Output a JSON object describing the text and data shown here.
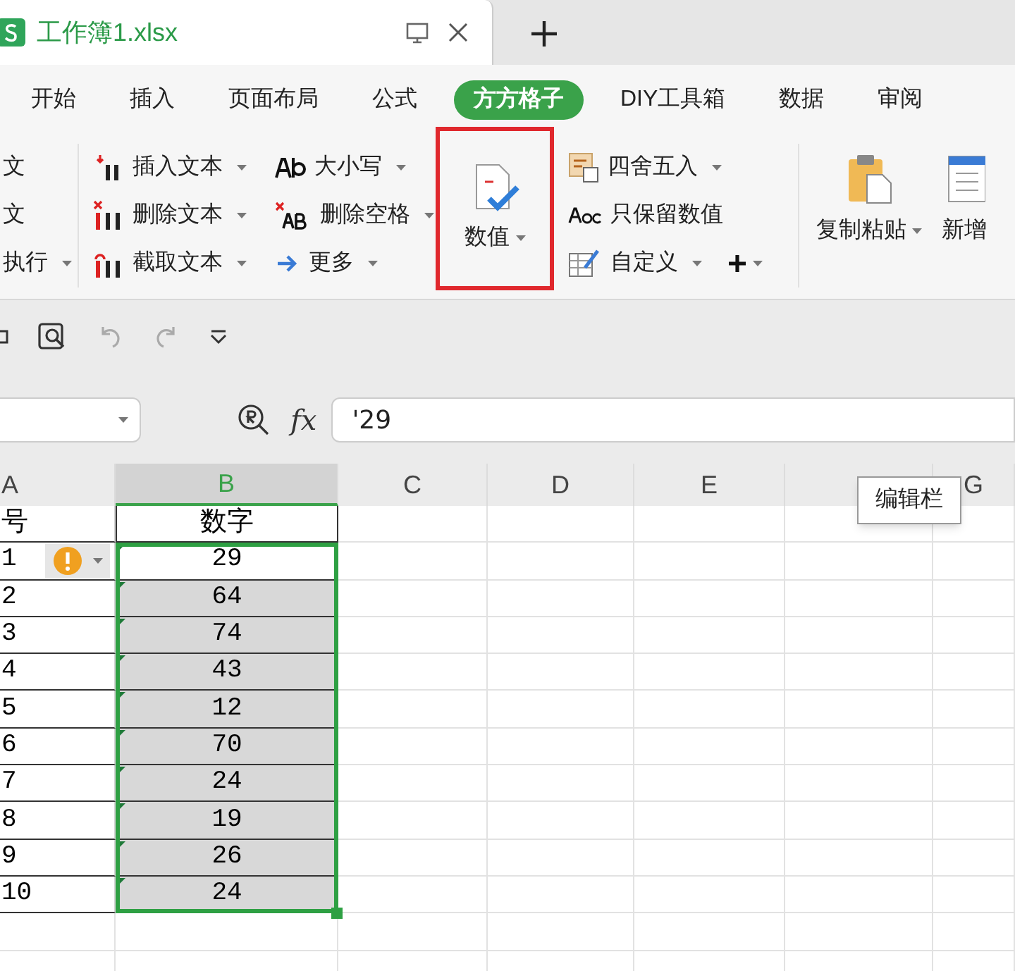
{
  "document_tab": {
    "title": "工作簿1.xlsx"
  },
  "ribbon_tabs": [
    {
      "label": "开始",
      "selected": false
    },
    {
      "label": "插入",
      "selected": false
    },
    {
      "label": "页面布局",
      "selected": false
    },
    {
      "label": "公式",
      "selected": false
    },
    {
      "label": "方方格子",
      "selected": true
    },
    {
      "label": "DIY工具箱",
      "selected": false
    },
    {
      "label": "数据",
      "selected": false
    },
    {
      "label": "审阅",
      "selected": false
    }
  ],
  "ribbon_groups": [
    {
      "kind": "stack",
      "items": [
        {
          "label": "文",
          "dropdown": false
        },
        {
          "label": "文",
          "dropdown": false
        },
        {
          "label": "执行",
          "dropdown": true
        }
      ]
    },
    {
      "kind": "stack",
      "items": [
        {
          "label": "插入文本",
          "dropdown": true
        },
        {
          "label": "删除文本",
          "dropdown": true
        },
        {
          "label": "截取文本",
          "dropdown": true
        }
      ]
    },
    {
      "kind": "stack",
      "items": [
        {
          "label": "大小写",
          "dropdown": true
        },
        {
          "label": "删除空格",
          "dropdown": true
        },
        {
          "label": "更多",
          "dropdown": true
        }
      ]
    },
    {
      "kind": "big",
      "items": [
        {
          "label": "数值",
          "dropdown": true,
          "highlighted": true
        }
      ]
    },
    {
      "kind": "stack",
      "items": [
        {
          "label": "四舍五入",
          "dropdown": true
        },
        {
          "label": "只保留数值",
          "dropdown": false
        },
        {
          "label": "自定义",
          "dropdown": true
        }
      ]
    },
    {
      "kind": "big",
      "items": [
        {
          "label": "复制粘贴",
          "dropdown": true,
          "highlighted": false
        },
        {
          "label": "新增",
          "dropdown": false,
          "highlighted": false
        }
      ]
    }
  ],
  "formula_bar": {
    "fx": "fx",
    "value": "'29"
  },
  "columns": [
    {
      "label": "A",
      "selected": false
    },
    {
      "label": "B",
      "selected": true
    },
    {
      "label": "C",
      "selected": false
    },
    {
      "label": "D",
      "selected": false
    },
    {
      "label": "E",
      "selected": false
    },
    {
      "selected": false
    },
    {
      "label": "G",
      "selected": false
    }
  ],
  "rows": [
    {
      "a": "号",
      "b": "数字",
      "warning": false
    },
    {
      "a": "1",
      "b": "29",
      "warning": true
    },
    {
      "a": "2",
      "b": "64",
      "warning": false
    },
    {
      "a": "3",
      "b": "74",
      "warning": false
    },
    {
      "a": "4",
      "b": "43",
      "warning": false
    },
    {
      "a": "5",
      "b": "12",
      "warning": false
    },
    {
      "a": "6",
      "b": "70",
      "warning": false
    },
    {
      "a": "7",
      "b": "24",
      "warning": false
    },
    {
      "a": "8",
      "b": "19",
      "warning": false
    },
    {
      "a": "9",
      "b": "26",
      "warning": false
    },
    {
      "a": "10",
      "b": "24",
      "warning": false
    }
  ],
  "tooltip": "编辑栏"
}
